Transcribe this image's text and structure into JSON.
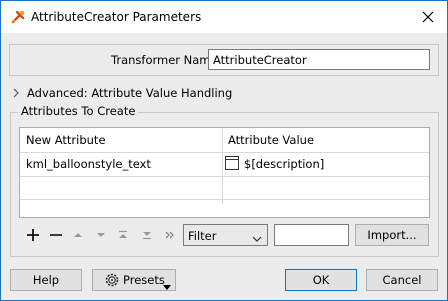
{
  "window": {
    "title": "AttributeCreator Parameters"
  },
  "transformer": {
    "label": "Transformer Name:",
    "value": "AttributeCreator"
  },
  "advanced": {
    "label": "Advanced: Attribute Value Handling"
  },
  "attributes": {
    "group_label": "Attributes To Create",
    "columns": [
      "New Attribute",
      "Attribute Value"
    ],
    "rows": [
      {
        "name": "kml_balloonstyle_text",
        "value": "$[description]"
      }
    ]
  },
  "toolbar": {
    "filter_selected": "Filter",
    "filter_value": "",
    "import_label": "Import..."
  },
  "footer": {
    "help_label": "Help",
    "presets_label": "Presets",
    "ok_label": "OK",
    "cancel_label": "Cancel"
  },
  "colors": {
    "accent": "#0078d7",
    "title_border": "#1e73be"
  }
}
